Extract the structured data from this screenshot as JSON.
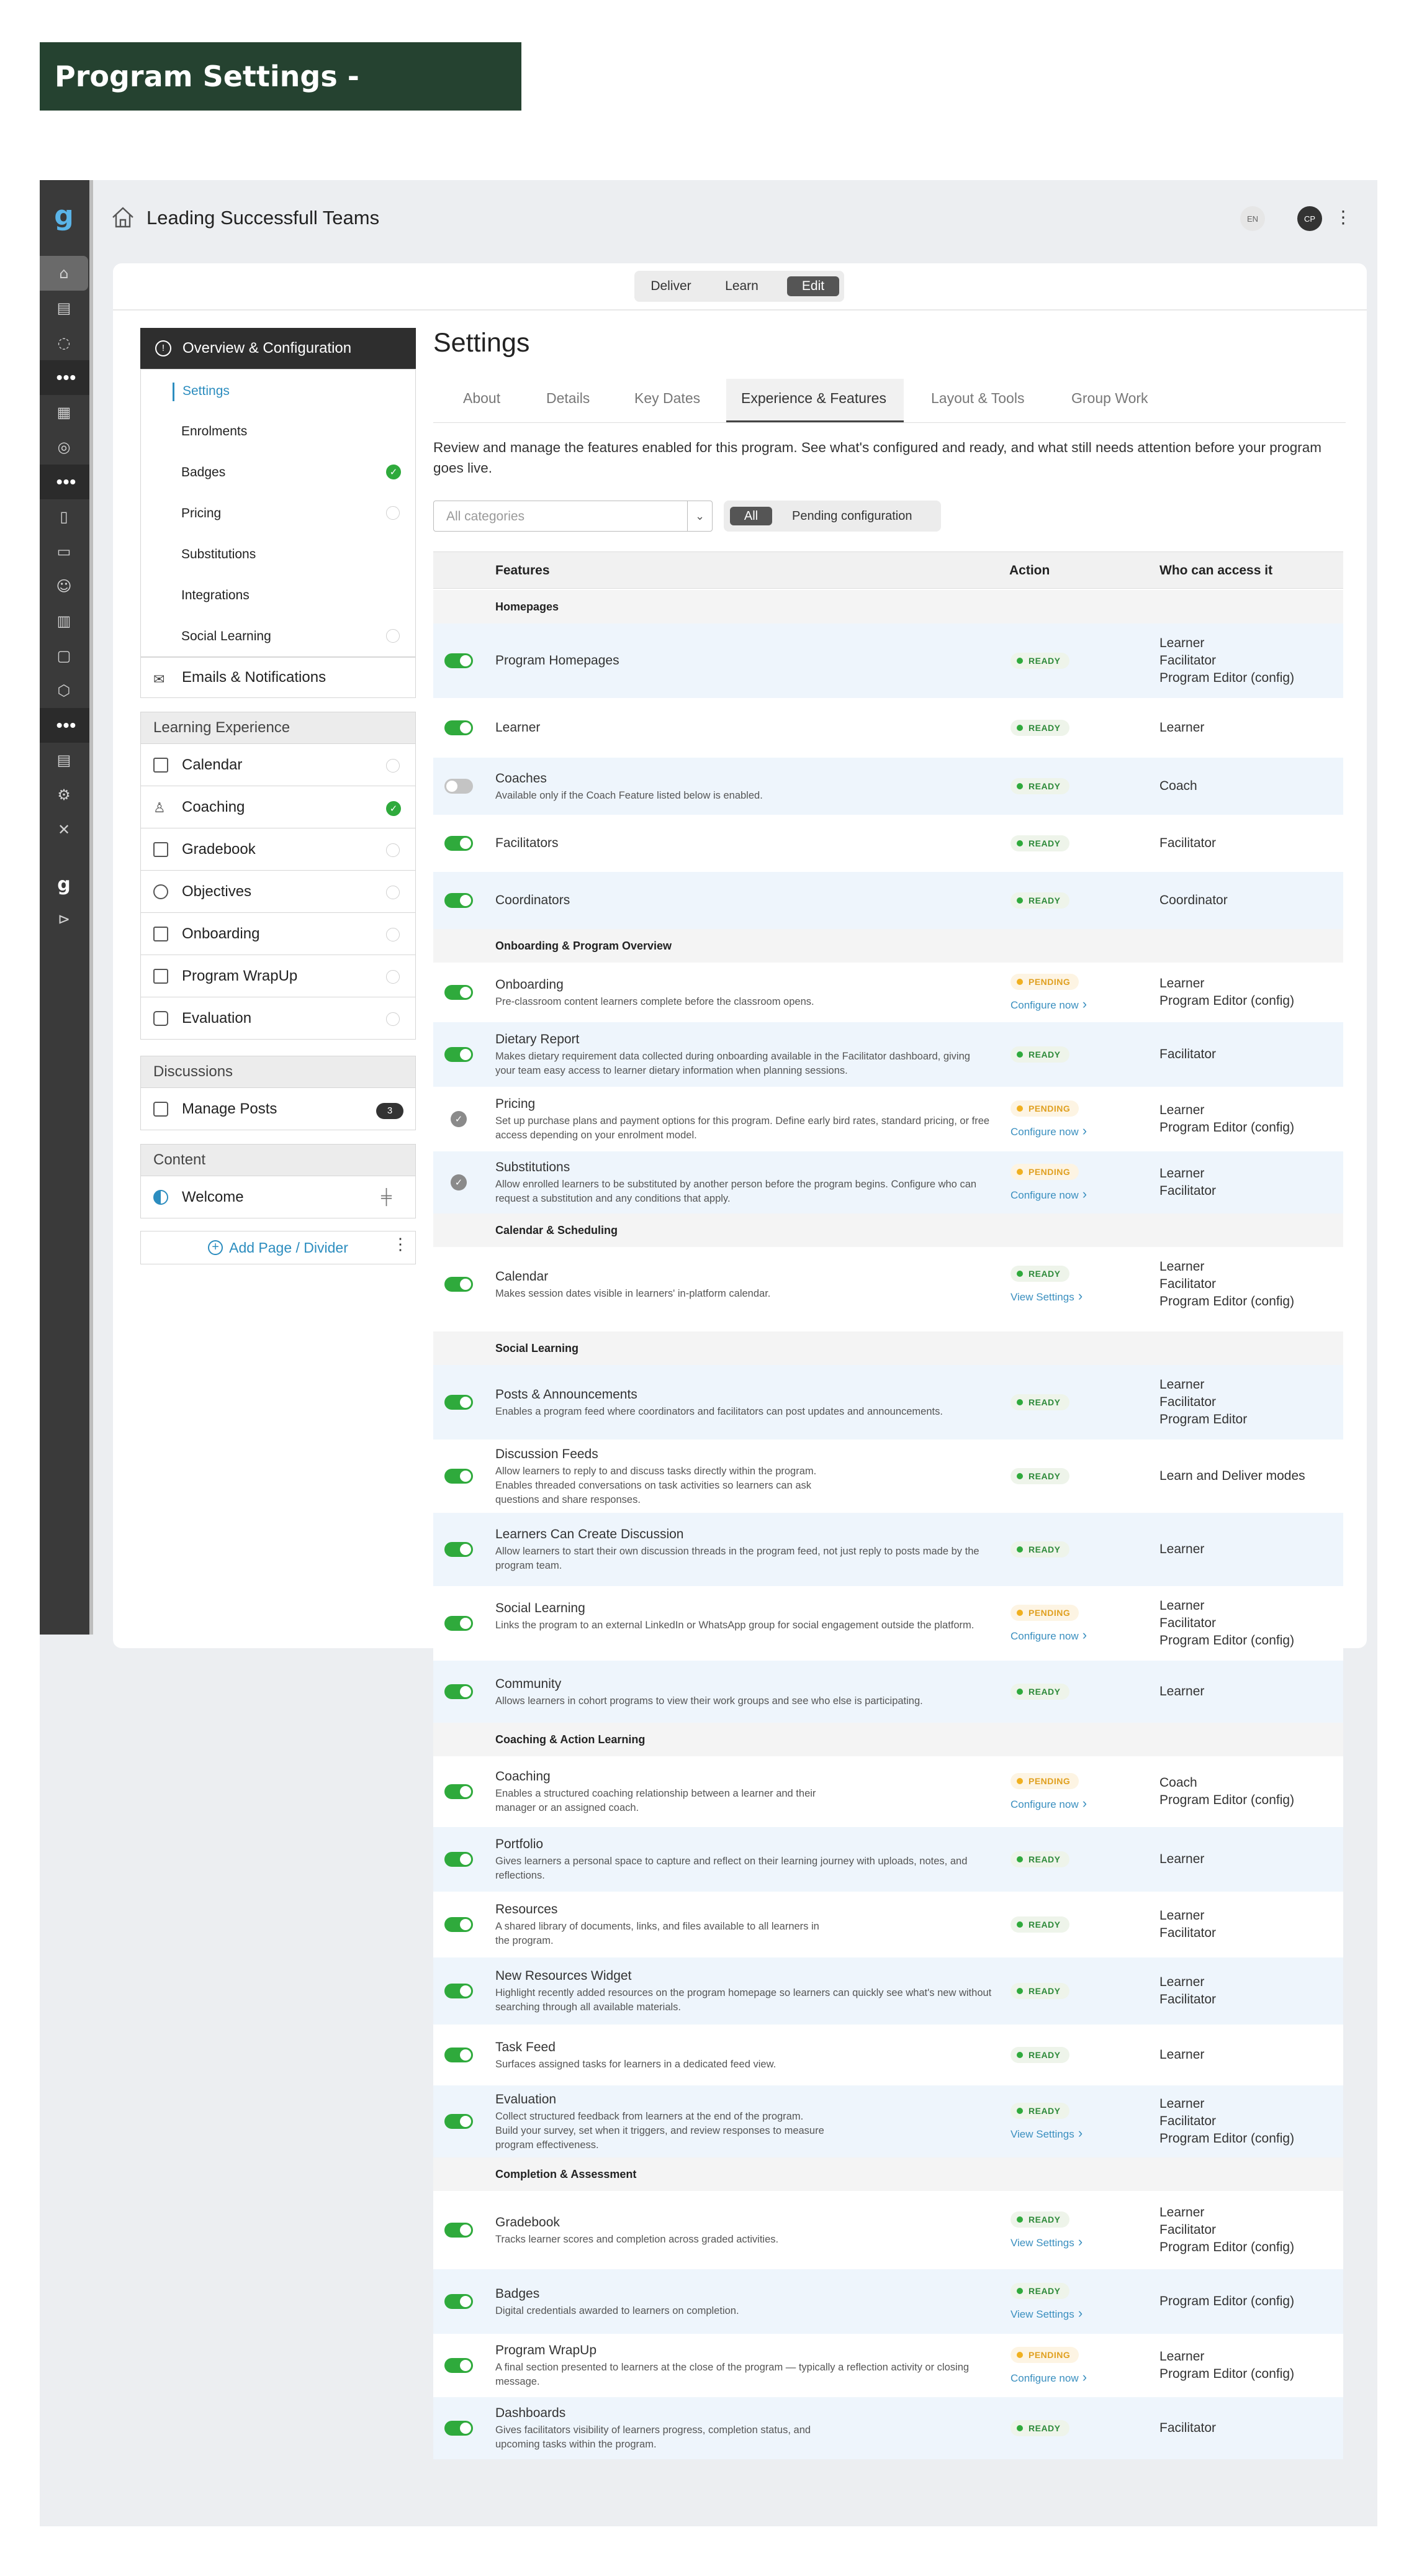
{
  "banner": "Program Settings - Experience",
  "program_title": "Leading Successfull Teams",
  "lang": "EN",
  "avatar": "CP",
  "modes": [
    "Deliver",
    "Learn",
    "Edit"
  ],
  "nav": {
    "head": "Overview & Configuration",
    "subs": [
      "Settings",
      "Enrolments",
      "Badges",
      "Pricing",
      "Substitutions",
      "Integrations",
      "Social Learning"
    ],
    "emails": "Emails & Notifications",
    "learning_section": "Learning Experience",
    "learning": [
      "Calendar",
      "Coaching",
      "Gradebook",
      "Objectives",
      "Onboarding",
      "Program WrapUp",
      "Evaluation"
    ],
    "discussions_section": "Discussions",
    "manage_posts": "Manage Posts",
    "manage_posts_count": "3",
    "content_section": "Content",
    "welcome": "Welcome",
    "add_page": "Add Page / Divider"
  },
  "settings_title": "Settings",
  "tabs": [
    "About",
    "Details",
    "Key Dates",
    "Experience & Features",
    "Layout & Tools",
    "Group Work"
  ],
  "description": "Review and manage the features enabled for this program. See what's configured and ready, and what still needs attention before your program goes live.",
  "filter": {
    "placeholder": "All categories",
    "all": "All",
    "pending": "Pending configuration"
  },
  "columns": {
    "features": "Features",
    "action": "Action",
    "access": "Who can access it"
  },
  "status_ready": "READY",
  "status_pending": "PENDING",
  "categories": [
    "Homepages",
    "Onboarding & Program Overview",
    "Calendar & Scheduling",
    "Social Learning",
    "Coaching & Action Learning",
    "Completion & Assessment"
  ],
  "features": [
    {
      "name": "Program Homepages",
      "desc": "",
      "access": "Learner\nFacilitator\nProgram Editor (config)",
      "link": ""
    },
    {
      "name": "Learner",
      "desc": "",
      "access": "Learner",
      "link": ""
    },
    {
      "name": "Coaches",
      "desc": "Available only if the Coach Feature listed below is enabled.",
      "access": "Coach",
      "link": ""
    },
    {
      "name": "Facilitators",
      "desc": "",
      "access": "Facilitator",
      "link": ""
    },
    {
      "name": "Coordinators",
      "desc": "",
      "access": "Coordinator",
      "link": ""
    },
    {
      "name": "Onboarding",
      "desc": "Pre-classroom content learners complete before the classroom opens.",
      "access": "Learner\nProgram Editor (config)",
      "link": "Configure now"
    },
    {
      "name": "Dietary Report",
      "desc": "Makes dietary requirement data collected during onboarding available in the Facilitator dashboard, giving your team easy access to learner dietary information when planning sessions.",
      "access": "Facilitator",
      "link": ""
    },
    {
      "name": "Pricing",
      "desc": "Set up purchase plans and payment options for this program. Define early bird rates, standard pricing, or free access depending on your enrolment model.",
      "access": "Learner\nProgram Editor (config)",
      "link": "Configure now"
    },
    {
      "name": "Substitutions",
      "desc": "Allow enrolled learners to be substituted by another person before the program begins. Configure who can request a substitution and any conditions that apply.",
      "access": "Learner\nFacilitator",
      "link": "Configure now"
    },
    {
      "name": "Calendar",
      "desc": "Makes session dates visible in learners' in-platform calendar.",
      "access": "Learner\nFacilitator\nProgram Editor (config)",
      "link": "View Settings"
    },
    {
      "name": "Posts & Announcements",
      "desc": "Enables a program feed where coordinators and facilitators can post updates and announcements.",
      "access": "Learner\nFacilitator\nProgram Editor",
      "link": ""
    },
    {
      "name": "Discussion Feeds",
      "desc": "Allow learners to reply to and discuss tasks directly within the program.\nEnables threaded conversations on task activities so learners can ask\nquestions and share responses.",
      "access": "Learn and Deliver modes",
      "link": ""
    },
    {
      "name": "Learners Can Create Discussion",
      "desc": "Allow learners to start their own discussion threads in the program feed, not just reply to posts made by the program team.",
      "access": "Learner",
      "link": ""
    },
    {
      "name": "Social Learning",
      "desc": "Links the program to an external LinkedIn or WhatsApp group for social engagement outside the platform.",
      "access": "Learner\nFacilitator\nProgram Editor (config)",
      "link": "Configure now"
    },
    {
      "name": "Community",
      "desc": "Allows learners in cohort programs to view their work groups and see who else is participating.",
      "access": "Learner",
      "link": ""
    },
    {
      "name": "Coaching",
      "desc": "Enables a structured coaching relationship between a learner and their\nmanager or an assigned coach.",
      "access": "Coach\nProgram Editor (config)",
      "link": "Configure now"
    },
    {
      "name": "Portfolio",
      "desc": "Gives learners a personal space to capture and reflect on their learning journey with uploads, notes, and reflections.",
      "access": "Learner",
      "link": ""
    },
    {
      "name": "Resources",
      "desc": "A shared library of documents, links, and files available to all learners in\nthe program.",
      "access": "Learner\nFacilitator",
      "link": ""
    },
    {
      "name": "New Resources Widget",
      "desc": "Highlight recently added resources on the program homepage so learners can quickly see what's new without searching through all available materials.",
      "access": "Learner\nFacilitator",
      "link": ""
    },
    {
      "name": "Task Feed",
      "desc": "Surfaces assigned tasks for learners in a dedicated feed view.",
      "access": "Learner",
      "link": ""
    },
    {
      "name": "Evaluation",
      "desc": "Collect structured feedback from learners at the end of the program.\nBuild your survey, set when it triggers, and review responses to measure\nprogram effectiveness.",
      "access": "Learner\nFacilitator\nProgram Editor (config)",
      "link": "View Settings"
    },
    {
      "name": "Gradebook",
      "desc": "Tracks learner scores and completion across graded activities.",
      "access": "Learner\nFacilitator\nProgram Editor (config)",
      "link": "View Settings"
    },
    {
      "name": "Badges",
      "desc": "Digital credentials awarded to learners on completion.",
      "access": "Program Editor (config)",
      "link": "View Settings"
    },
    {
      "name": "Program WrapUp",
      "desc": "A final section presented to learners at the close of the program — typically a reflection activity or closing message.",
      "access": "Learner\nProgram Editor (config)",
      "link": "Configure now"
    },
    {
      "name": "Dashboards",
      "desc": "Gives facilitators visibility of learners progress, completion status, and\nupcoming tasks within the program.",
      "access": "Facilitator",
      "link": ""
    }
  ]
}
